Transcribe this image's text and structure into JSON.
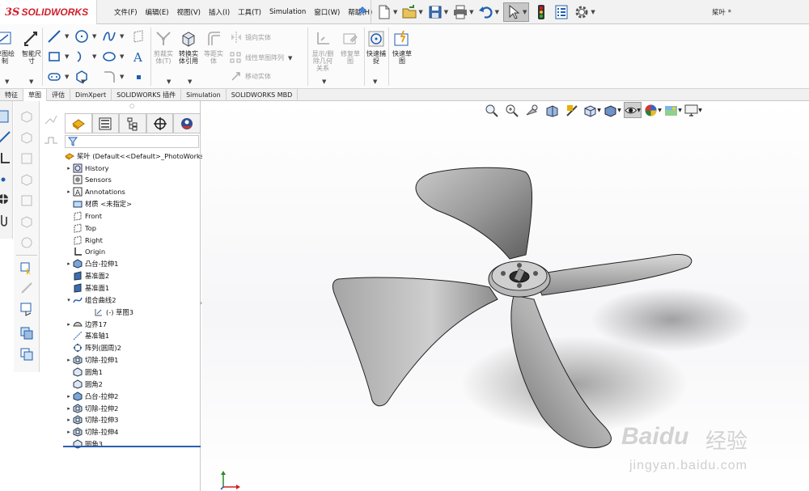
{
  "app": {
    "logo_prefix": "3S",
    "logo_name": "SOLIDWORKS",
    "document_title": "桨叶 *"
  },
  "menu": [
    "文件(F)",
    "编辑(E)",
    "视图(V)",
    "插入(I)",
    "工具(T)",
    "Simulation",
    "窗口(W)",
    "帮助(H)"
  ],
  "command_manager": {
    "sketch_button": "草图绘\n制",
    "smart_dim": "智能尺\n寸",
    "trim": "剪裁实\n体(T)",
    "convert": "转换实\n体引用",
    "offset": "等距实\n体",
    "mirror": "镜向实体",
    "linear_pattern": "线性草图阵列",
    "move": "移动实体",
    "display_relations": "显示/删\n除几何\n关系",
    "repair": "修复草\n图",
    "rapid_snap": "快速捕\n捉",
    "rapid_sketch": "快速草\n图"
  },
  "tabs": [
    "特征",
    "草图",
    "评估",
    "DimXpert",
    "SOLIDWORKS 插件",
    "Simulation",
    "SOLIDWORKS MBD"
  ],
  "active_tab": "草图",
  "feature_tree": {
    "root": "桨叶  (Default<<Default>_PhotoWorks",
    "items": [
      {
        "label": "History",
        "expandable": true,
        "indent": 1
      },
      {
        "label": "Sensors",
        "expandable": false,
        "indent": 1
      },
      {
        "label": "Annotations",
        "expandable": true,
        "indent": 1
      },
      {
        "label": "材质 <未指定>",
        "expandable": false,
        "indent": 1
      },
      {
        "label": "Front",
        "expandable": false,
        "indent": 1
      },
      {
        "label": "Top",
        "expandable": false,
        "indent": 1
      },
      {
        "label": "Right",
        "expandable": false,
        "indent": 1
      },
      {
        "label": "Origin",
        "expandable": false,
        "indent": 1
      },
      {
        "label": "凸台-拉伸1",
        "expandable": true,
        "indent": 1
      },
      {
        "label": "基准面2",
        "expandable": false,
        "indent": 1
      },
      {
        "label": "基准面1",
        "expandable": false,
        "indent": 1
      },
      {
        "label": "组合曲线2",
        "expandable": true,
        "expanded": true,
        "indent": 1
      },
      {
        "label": "(-) 草图3",
        "expandable": false,
        "indent": 2
      },
      {
        "label": "边界17",
        "expandable": true,
        "indent": 1
      },
      {
        "label": "基准轴1",
        "expandable": false,
        "indent": 1
      },
      {
        "label": "阵列(圆周)2",
        "expandable": false,
        "indent": 1
      },
      {
        "label": "切除-拉伸1",
        "expandable": true,
        "indent": 1
      },
      {
        "label": "圆角1",
        "expandable": false,
        "indent": 1
      },
      {
        "label": "圆角2",
        "expandable": false,
        "indent": 1
      },
      {
        "label": "凸台-拉伸2",
        "expandable": true,
        "indent": 1
      },
      {
        "label": "切除-拉伸2",
        "expandable": true,
        "indent": 1
      },
      {
        "label": "切除-拉伸3",
        "expandable": true,
        "indent": 1
      },
      {
        "label": "切除-拉伸4",
        "expandable": true,
        "indent": 1
      },
      {
        "label": "圆角3",
        "expandable": false,
        "indent": 1
      }
    ]
  },
  "watermark": {
    "main": "Bai",
    "main2": "du",
    "cn": "经验",
    "sub": "jingyan.baidu.com"
  },
  "colors": {
    "brand_red": "#d0202a",
    "tree_selected_line": "#2a5fb0",
    "part_gray": "#8f8f8f"
  }
}
